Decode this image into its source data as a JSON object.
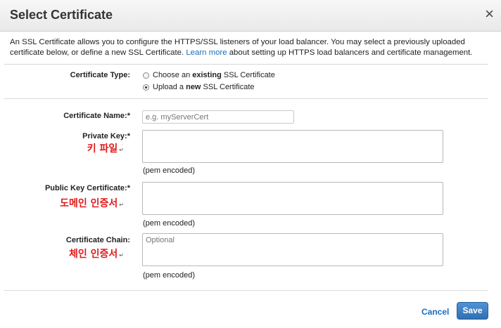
{
  "dialog": {
    "title": "Select Certificate",
    "close_glyph": "×",
    "description_pre": "An SSL Certificate allows you to configure the HTTPS/SSL listeners of your load balancer. You may select a previously uploaded certificate below, or define a new SSL Certificate. ",
    "description_link": "Learn more",
    "description_post": " about setting up HTTPS load balancers and certificate management."
  },
  "cert_type": {
    "label": "Certificate Type:",
    "option_existing_pre": "Choose an ",
    "option_existing_bold": "existing",
    "option_existing_post": " SSL Certificate",
    "option_upload_pre": "Upload a ",
    "option_upload_bold": "new",
    "option_upload_post": " SSL Certificate",
    "selected": "upload"
  },
  "fields": {
    "name_label": "Certificate Name:*",
    "name_placeholder": "e.g. myServerCert",
    "private_key_label": "Private Key:*",
    "private_key_annotation": "키 파일",
    "public_cert_label": "Public Key Certificate:*",
    "public_cert_annotation": "도메인 인증서",
    "chain_label": "Certificate Chain:",
    "chain_annotation": "체인 인증서",
    "chain_placeholder": "Optional",
    "pem_note": "(pem encoded)",
    "return_glyph": "↵"
  },
  "footer": {
    "cancel_label": "Cancel",
    "save_label": "Save"
  },
  "colors": {
    "link": "#1a6dbf",
    "annotation": "#e01a1a",
    "save_button": "#3a7fc4"
  }
}
